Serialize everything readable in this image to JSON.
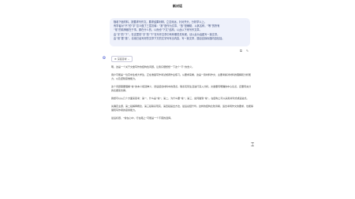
{
  "header": {
    "title": "新对话"
  },
  "user_message": {
    "lines": [
      "随着下面材料，按要求写作文。要求结果利明，立意深远，针对开头，分析学以上。",
      "有学者对“不”的“字”意义做了三层次释：“常”是作为文章，“放”是辅助、以其名称，“等”的所有",
      "“常”的精神都在于事，那在什么的，以而也“下文”结构，以此以下来写作文章。",
      "由“字”的“下”，在这里的“字”的“下”在写作文章中有有哪些关系呢，请以此为话题写一篇文章。",
      "由“常”更“旅”。请用已经写好的文章下方的文字列写出内容，写一篇文章，题目自拟标题内容包括。"
    ]
  },
  "message_actions": [
    {
      "icon": "copy-icon",
      "glyph": "⧉"
    },
    {
      "icon": "edit-icon",
      "glyph": "✎"
    }
  ],
  "assistant": {
    "avatar_icon": "assistant-logo-icon",
    "model_label": "深度思考",
    "paragraphs": [
      "嗯，这是一个关于文章写作的结构性问题。让我仔细想想一下这个“不”的含义。",
      "用户可能是一位高中生或大学生，正在准备写作考试或者作业练习。从要求来看，这是一篇材料作文，主要考察对材料的理解和分析能力，以及逻辑思维能力。",
      "这个问题需要理解“常”的本义和延伸义，然后结合材料中的观点，联系实际生活进行深入分析。文章要有明确的中心论点，还要有充分的论据来支撑。",
      "我想可以从几个方面来思考：第一，什么是“常”；第二，为什么要“常”；第三，如何做到“常”。在结构上可以采用并列式或递进式。",
      "先确定主题，第二段解释概念，第三段联系现实，第四段提出方法，最后总结升华。这样的结构比较清晰，适合考场作文的要求，也能够展现写作者的思辨能力。",
      "最后标题，“常在心中，行在路上”可能是一个不错的选择。"
    ]
  }
}
